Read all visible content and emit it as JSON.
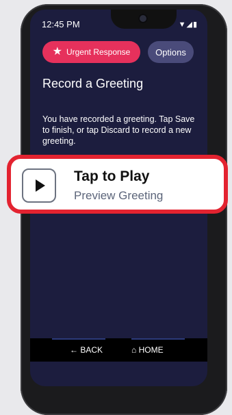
{
  "status_bar": {
    "time": "12:45 PM",
    "icons": "▼◢▮"
  },
  "header": {
    "urgent_label": "Urgent Response",
    "urgent_icon": "star-icon",
    "options_label": "Options"
  },
  "page": {
    "title": "Record a Greeting",
    "description": "You have recorded a greeting. Tap Save to finish, or tap Discard to record a new greeting."
  },
  "callout": {
    "primary": "Tap to Play",
    "secondary": "Preview Greeting",
    "icon": "play-icon"
  },
  "nav": {
    "back_label": "← BACK",
    "home_label": "HOME",
    "home_icon": "home-icon"
  },
  "colors": {
    "accent": "#e6315c",
    "highlight": "#e32330",
    "screen_bg": "#1c1d3e",
    "options_bg": "#4a4b7a"
  }
}
